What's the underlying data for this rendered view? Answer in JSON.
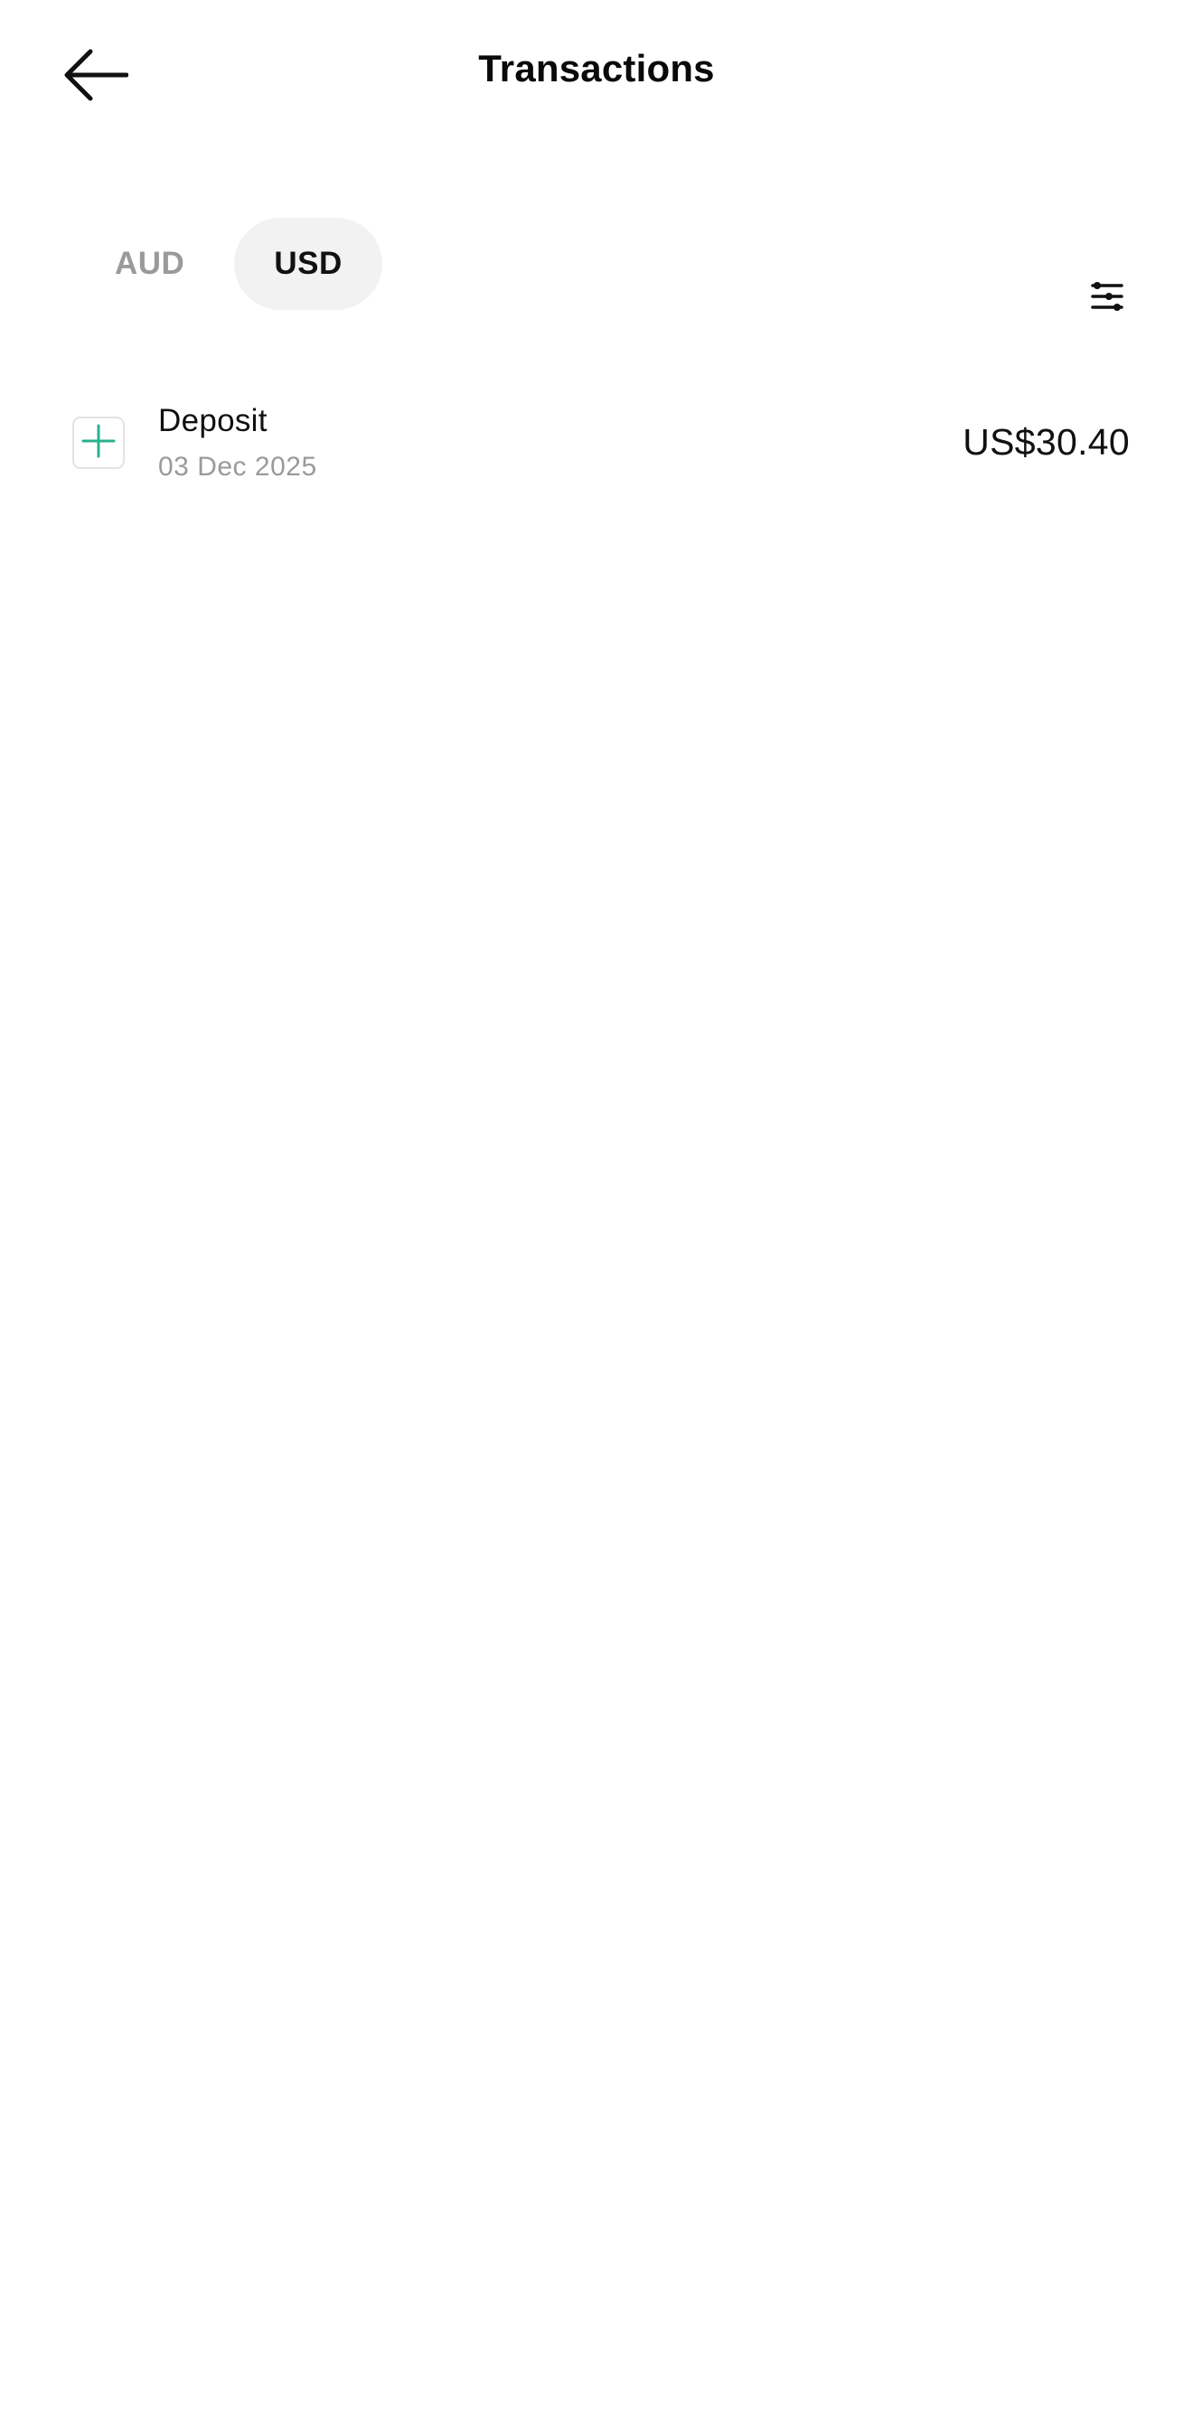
{
  "header": {
    "title": "Transactions",
    "back_icon": "arrow-left-icon"
  },
  "currency_tabs": [
    {
      "label": "AUD",
      "selected": false
    },
    {
      "label": "USD",
      "selected": true
    }
  ],
  "filter": {
    "icon": "filter-sliders-icon"
  },
  "transactions": [
    {
      "icon": "plus-icon",
      "name": "Deposit",
      "date": "03 Dec 2025",
      "amount": "US$30.40"
    }
  ],
  "colors": {
    "background": "#ffffff",
    "text_primary": "#111111",
    "text_secondary": "#9a9a9a",
    "tab_active_bg": "#f2f2f2",
    "deposit_accent": "#2bb08f"
  }
}
